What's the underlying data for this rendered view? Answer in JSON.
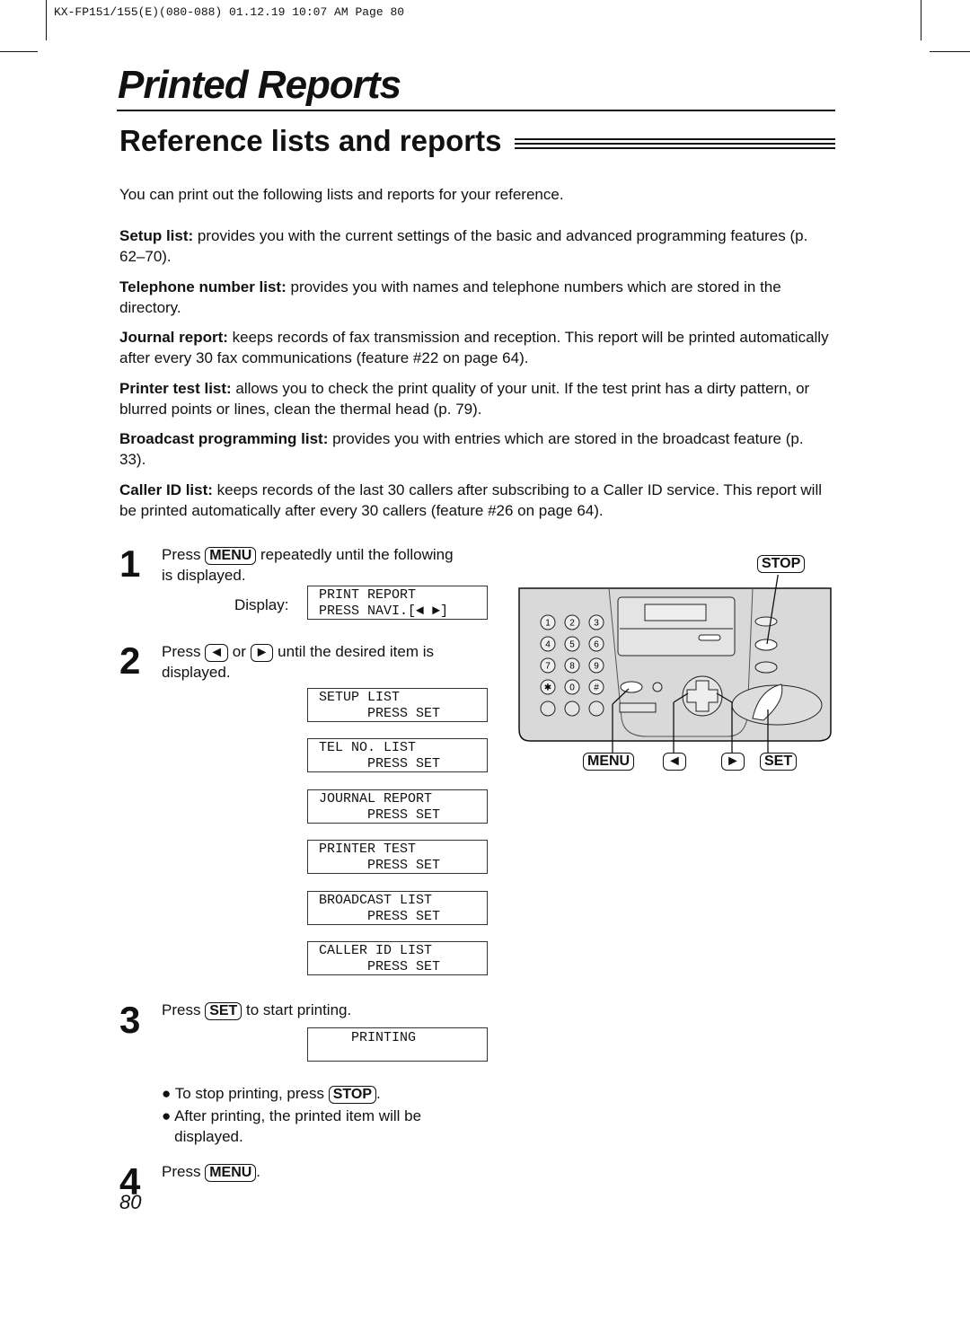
{
  "print_header": "KX-FP151/155(E)(080-088)  01.12.19  10:07 AM  Page 80",
  "title": "Printed Reports",
  "section": "Reference lists and reports",
  "intro": "You can print out the following lists and reports for your reference.",
  "items": [
    {
      "term": "Setup list:",
      "text": " provides you with the current settings of the basic and advanced programming features (p. 62–70)."
    },
    {
      "term": "Telephone number list:",
      "text": " provides you with names and telephone numbers which are stored in the directory."
    },
    {
      "term": "Journal report:",
      "text": " keeps records of fax transmission and reception. This report will be printed automatically after every 30 fax communications (feature #22 on page 64)."
    },
    {
      "term": "Printer test list:",
      "text": " allows you to check the print quality of your unit. If the test print has a dirty pattern, or blurred points or lines, clean the thermal head (p. 79)."
    },
    {
      "term": "Broadcast programming list:",
      "text": " provides you with entries which are stored in the broadcast feature (p. 33)."
    },
    {
      "term": "Caller ID list:",
      "text": " keeps records of the last 30 callers after subscribing to a Caller ID service. This report will be printed automatically after every 30 callers (feature #26 on page 64)."
    }
  ],
  "steps": {
    "s1": {
      "num": "1",
      "a": "Press ",
      "key": "MENU",
      "b": " repeatedly until the following",
      "c": "is displayed.",
      "display_label": "Display:",
      "lcd": [
        "PRINT REPORT",
        "PRESS NAVI.[◄ ►]"
      ]
    },
    "s2": {
      "num": "2",
      "a": "Press ",
      "k1": "◄",
      "or": " or ",
      "k2": "►",
      "b": " until the desired item is",
      "c": "displayed.",
      "lcds": [
        [
          "SETUP LIST",
          "      PRESS SET"
        ],
        [
          "TEL NO. LIST",
          "      PRESS SET"
        ],
        [
          "JOURNAL REPORT",
          "      PRESS SET"
        ],
        [
          "PRINTER TEST",
          "      PRESS SET"
        ],
        [
          "BROADCAST LIST",
          "      PRESS SET"
        ],
        [
          "CALLER ID LIST",
          "      PRESS SET"
        ]
      ]
    },
    "s3": {
      "num": "3",
      "a": "Press ",
      "key": "SET",
      "b": " to start printing.",
      "lcd": "    PRINTING",
      "bullet1a": "To stop printing, press ",
      "bullet1key": "STOP",
      "bullet1b": ".",
      "bullet2": "After printing, the printed item will be",
      "bullet2b": "displayed."
    },
    "s4": {
      "num": "4",
      "a": "Press ",
      "key": "MENU",
      "b": "."
    }
  },
  "diagram": {
    "stop": "STOP",
    "menu": "MENU",
    "left": "◄",
    "right": "►",
    "set": "SET",
    "keys": [
      "1",
      "2",
      "3",
      "4",
      "5",
      "6",
      "7",
      "8",
      "9",
      "✱",
      "0",
      "#"
    ]
  },
  "page_number": "80"
}
